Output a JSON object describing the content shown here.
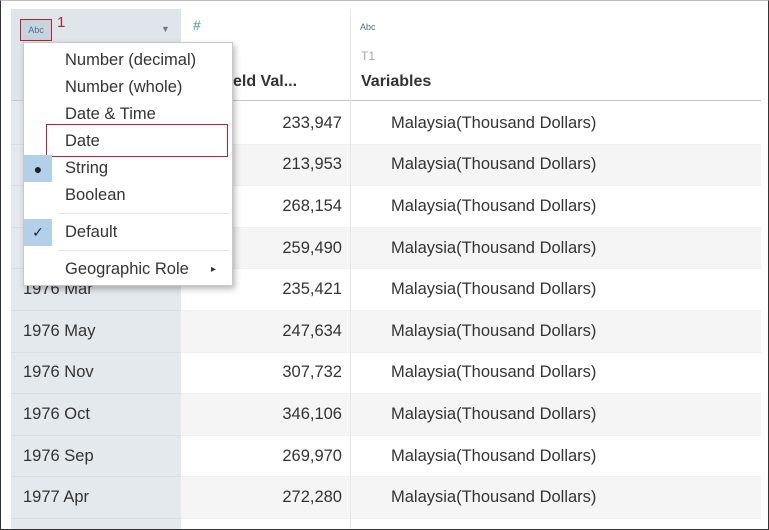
{
  "annotation": {
    "step_number": "1"
  },
  "columns": {
    "c1": {
      "type_icon": "Abc"
    },
    "c2": {
      "type_icon": "#",
      "title": "t Field Val..."
    },
    "c3": {
      "type_icon": "Abc",
      "subtitle": "T1",
      "title": "Variables"
    }
  },
  "rows": [
    {
      "c1": "",
      "c2": "233,947",
      "c3": "Malaysia(Thousand Dollars)"
    },
    {
      "c1": "",
      "c2": "213,953",
      "c3": "Malaysia(Thousand Dollars)"
    },
    {
      "c1": "",
      "c2": "268,154",
      "c3": "Malaysia(Thousand Dollars)"
    },
    {
      "c1": "",
      "c2": "259,490",
      "c3": "Malaysia(Thousand Dollars)"
    },
    {
      "c1": "1976 Mar",
      "c2": "235,421",
      "c3": "Malaysia(Thousand Dollars)"
    },
    {
      "c1": "1976 May",
      "c2": "247,634",
      "c3": "Malaysia(Thousand Dollars)"
    },
    {
      "c1": "1976 Nov",
      "c2": "307,732",
      "c3": "Malaysia(Thousand Dollars)"
    },
    {
      "c1": "1976 Oct",
      "c2": "346,106",
      "c3": "Malaysia(Thousand Dollars)"
    },
    {
      "c1": "1976 Sep",
      "c2": "269,970",
      "c3": "Malaysia(Thousand Dollars)"
    },
    {
      "c1": "1977 Apr",
      "c2": "272,280",
      "c3": "Malaysia(Thousand Dollars)"
    }
  ],
  "menu": {
    "number_decimal": "Number (decimal)",
    "number_whole": "Number (whole)",
    "date_time": "Date & Time",
    "date": "Date",
    "string": "String",
    "boolean": "Boolean",
    "default": "Default",
    "geographic_role": "Geographic Role",
    "string_marker": "●",
    "default_marker": "✓",
    "submenu_arrow": "▸"
  },
  "colors": {
    "highlight_red": "#b2262b",
    "selected_gutter": "#b3d0ea",
    "number_icon": "#3fa37c",
    "string_icon": "#4e6f89"
  },
  "icons": {
    "dropdown": "chevron-down-icon",
    "number_type": "hash-icon",
    "string_type": "abc-icon",
    "selected": "bullet-icon",
    "checked": "checkmark-icon",
    "submenu": "chevron-right-icon"
  }
}
